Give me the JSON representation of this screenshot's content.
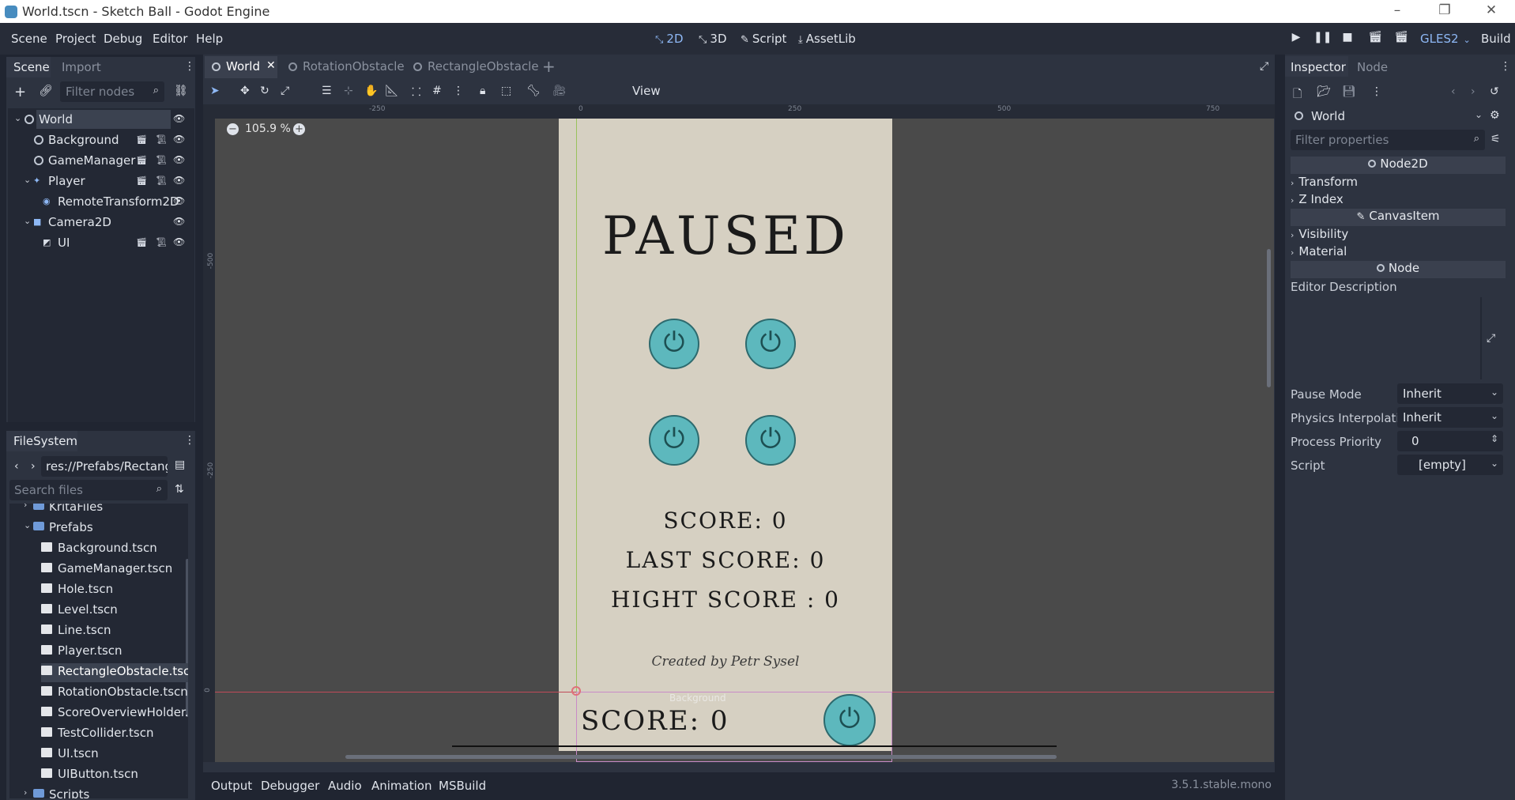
{
  "window": {
    "title": "World.tscn - Sketch Ball - Godot Engine"
  },
  "menu": {
    "items": [
      "Scene",
      "Project",
      "Debug",
      "Editor",
      "Help"
    ],
    "modes": [
      "2D",
      "3D",
      "Script",
      "AssetLib"
    ],
    "renderer": "GLES2",
    "build": "Build"
  },
  "scene_dock": {
    "tabs": [
      "Scene",
      "Import"
    ],
    "filter_placeholder": "Filter nodes",
    "nodes": [
      {
        "label": "World",
        "depth": 0,
        "selected": true
      },
      {
        "label": "Background",
        "depth": 1
      },
      {
        "label": "GameManager",
        "depth": 1
      },
      {
        "label": "Player",
        "depth": 1
      },
      {
        "label": "RemoteTransform2D",
        "depth": 2
      },
      {
        "label": "Camera2D",
        "depth": 1
      },
      {
        "label": "UI",
        "depth": 2
      }
    ]
  },
  "filesystem": {
    "tab": "FileSystem",
    "path": "res://Prefabs/Rectangl",
    "search_placeholder": "Search files",
    "items": [
      {
        "label": "KritaFiles",
        "type": "folder"
      },
      {
        "label": "Prefabs",
        "type": "folder"
      },
      {
        "label": "Background.tscn",
        "type": "file"
      },
      {
        "label": "GameManager.tscn",
        "type": "file"
      },
      {
        "label": "Hole.tscn",
        "type": "file"
      },
      {
        "label": "Level.tscn",
        "type": "file"
      },
      {
        "label": "Line.tscn",
        "type": "file"
      },
      {
        "label": "Player.tscn",
        "type": "file"
      },
      {
        "label": "RectangleObstacle.tsc",
        "type": "file",
        "selected": true
      },
      {
        "label": "RotationObstacle.tscn",
        "type": "file"
      },
      {
        "label": "ScoreOverviewHolder.t",
        "type": "file"
      },
      {
        "label": "TestCollider.tscn",
        "type": "file"
      },
      {
        "label": "UI.tscn",
        "type": "file"
      },
      {
        "label": "UIButton.tscn",
        "type": "file"
      },
      {
        "label": "Scripts",
        "type": "folder"
      }
    ]
  },
  "editor_tabs": [
    "World",
    "RotationObstacle",
    "RectangleObstacle"
  ],
  "toolbar": {
    "view": "View",
    "zoom": "105.9 %"
  },
  "ruler": {
    "h_ticks": [
      "-250",
      "0",
      "250",
      "500",
      "750"
    ],
    "v_ticks": [
      "-500",
      "-250",
      "0"
    ]
  },
  "game_ui": {
    "paused": "PAUSED",
    "score": "SCORE: 0",
    "last_score": "LAST SCORE: 0",
    "high_score": "HIGHT SCORE : 0",
    "credits": "Created by Petr Sysel",
    "hud_score": "SCORE: 0",
    "bg_label": "Background"
  },
  "bottom_panel": {
    "tabs": [
      "Output",
      "Debugger",
      "Audio",
      "Animation",
      "MSBuild"
    ],
    "version": "3.5.1.stable.mono"
  },
  "inspector": {
    "tabs": [
      "Inspector",
      "Node"
    ],
    "object": "World",
    "filter_placeholder": "Filter properties",
    "sections": {
      "node2d": "Node2D",
      "transform": "Transform",
      "zindex": "Z Index",
      "canvasitem": "CanvasItem",
      "visibility": "Visibility",
      "material": "Material",
      "node": "Node",
      "editor_description": "Editor Description"
    },
    "props": [
      {
        "label": "Pause Mode",
        "value": "Inherit"
      },
      {
        "label": "Physics Interpolati",
        "value": "Inherit"
      },
      {
        "label": "Process Priority",
        "value": "0"
      },
      {
        "label": "Script",
        "value": "[empty]"
      }
    ]
  },
  "colors": {
    "accent": "#8eb8f5",
    "button_teal": "#5db8bd",
    "paper": "#d6d0c2"
  }
}
